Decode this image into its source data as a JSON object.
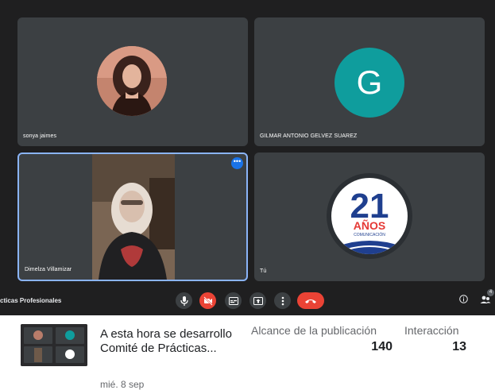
{
  "participants": [
    {
      "name": "sonya jaimes"
    },
    {
      "name": "GILMAR ANTONIO GELVEZ SUAREZ",
      "initial": "G"
    },
    {
      "name": "Dimelza Villamizar"
    },
    {
      "name": "Tú"
    }
  ],
  "logo": {
    "number": "21",
    "word": "AÑOS",
    "sub": "COMUNICACIÓN"
  },
  "meeting": {
    "title": "cticas Profesionales",
    "people_count": "4"
  },
  "post": {
    "text": "A esta hora se desarrollo Comité de Prácticas...",
    "date": "mié. 8 sep",
    "reach_label": "Alcance de la publicación",
    "reach_value": "140",
    "interaction_label": "Interacción",
    "interaction_value": "13"
  },
  "colors": {
    "accent": "#1a73e8",
    "hangup": "#ea4335",
    "avatar_g": "#0f9d9d",
    "tile": "#3c4043",
    "background": "#1f1f20"
  }
}
